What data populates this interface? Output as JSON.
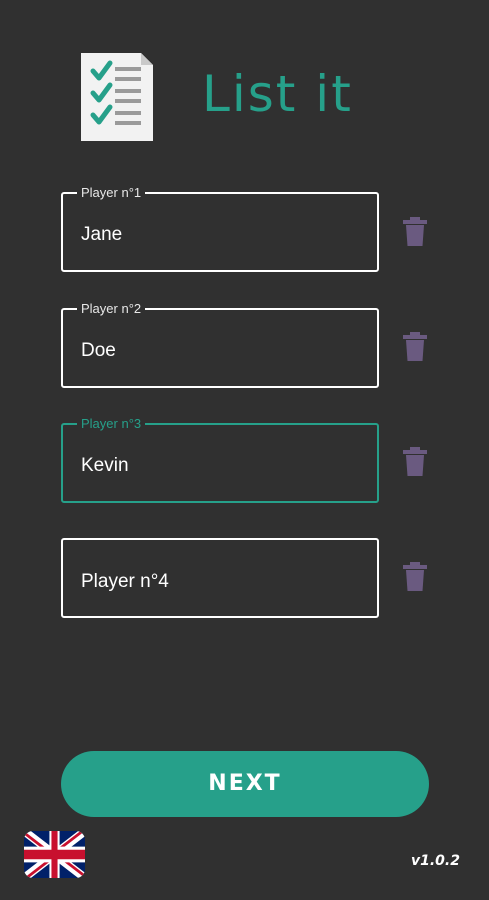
{
  "app": {
    "title": "List it",
    "logo_icon": "checklist-document-icon",
    "version": "v1.0.2"
  },
  "players": [
    {
      "label": "Player n°1",
      "value": "Jane",
      "placeholder": "",
      "focused": false
    },
    {
      "label": "Player n°2",
      "value": "Doe",
      "placeholder": "",
      "focused": false
    },
    {
      "label": "Player n°3",
      "value": "Kevin",
      "placeholder": "",
      "focused": true
    },
    {
      "label": "",
      "value": "",
      "placeholder": "Player n°4",
      "focused": false
    }
  ],
  "actions": {
    "next_label": "NEXT",
    "delete_icon": "trash-icon"
  },
  "language": {
    "flag_icon": "uk-flag-icon"
  },
  "colors": {
    "background": "#303030",
    "accent": "#26a08a",
    "delete_icon": "#6a5a80",
    "text": "#ffffff"
  }
}
